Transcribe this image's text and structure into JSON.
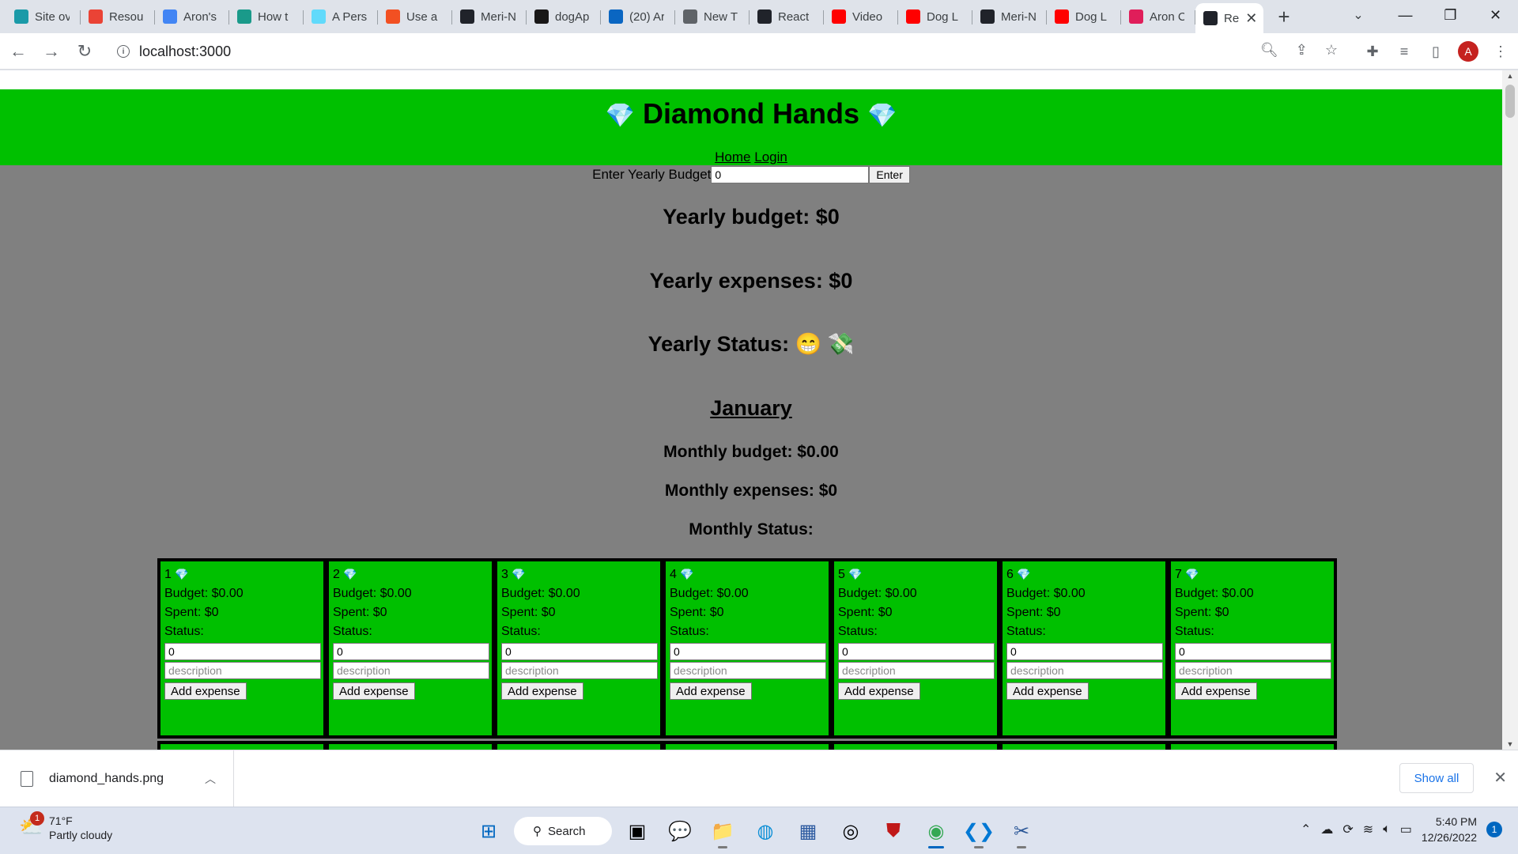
{
  "browser": {
    "tabs": [
      {
        "label": "Site ov",
        "icon": "diamond-icon",
        "color": "#1a9aa8"
      },
      {
        "label": "Resou",
        "icon": "gmail-icon",
        "color": "#ea4335"
      },
      {
        "label": "Aron's",
        "icon": "docs-icon",
        "color": "#4285f4"
      },
      {
        "label": "How t",
        "icon": "link-icon",
        "color": "#1a9a8a"
      },
      {
        "label": "A Pers",
        "icon": "react-icon",
        "color": "#61dafb"
      },
      {
        "label": "Use a",
        "icon": "microsoft-icon",
        "color": "#f25022"
      },
      {
        "label": "Meri-N",
        "icon": "react-icon",
        "color": "#20232a"
      },
      {
        "label": "dogAp",
        "icon": "github-icon",
        "color": "#181717"
      },
      {
        "label": "(20) Ar",
        "icon": "linkedin-icon",
        "color": "#0a66c2"
      },
      {
        "label": "New T",
        "icon": "chrome-icon",
        "color": "#5f6368"
      },
      {
        "label": "React",
        "icon": "react-icon",
        "color": "#20232a"
      },
      {
        "label": "Video",
        "icon": "youtube-icon",
        "color": "#ff0000"
      },
      {
        "label": "Dog L",
        "icon": "youtube-icon",
        "color": "#ff0000"
      },
      {
        "label": "Meri-N",
        "icon": "react-icon",
        "color": "#20232a"
      },
      {
        "label": "Dog L",
        "icon": "youtube-icon",
        "color": "#ff0000"
      },
      {
        "label": "Aron C",
        "icon": "slack-icon",
        "color": "#e01e5a"
      }
    ],
    "active_tab": {
      "label": "Re",
      "icon": "react-icon"
    },
    "url": "localhost:3000",
    "profile_initial": "A"
  },
  "app": {
    "title": "Diamond Hands",
    "gem": "💎",
    "nav": {
      "home": "Home",
      "login": "Login"
    },
    "budget_form": {
      "label": "Enter Yearly Budget",
      "value": "0",
      "button": "Enter"
    },
    "yearly_budget": "Yearly budget: $0",
    "yearly_expenses": "Yearly expenses: $0",
    "yearly_status": "Yearly Status: 😁 💸",
    "month": "January",
    "monthly_budget": "Monthly budget: $0.00",
    "monthly_expenses": "Monthly expenses: $0",
    "monthly_status": "Monthly Status:",
    "days": [
      {
        "num": "1",
        "budget": "Budget: $0.00",
        "spent": "Spent: $0",
        "status": "Status:",
        "amount": "0",
        "desc_placeholder": "description",
        "button": "Add expense"
      },
      {
        "num": "2",
        "budget": "Budget: $0.00",
        "spent": "Spent: $0",
        "status": "Status:",
        "amount": "0",
        "desc_placeholder": "description",
        "button": "Add expense"
      },
      {
        "num": "3",
        "budget": "Budget: $0.00",
        "spent": "Spent: $0",
        "status": "Status:",
        "amount": "0",
        "desc_placeholder": "description",
        "button": "Add expense"
      },
      {
        "num": "4",
        "budget": "Budget: $0.00",
        "spent": "Spent: $0",
        "status": "Status:",
        "amount": "0",
        "desc_placeholder": "description",
        "button": "Add expense"
      },
      {
        "num": "5",
        "budget": "Budget: $0.00",
        "spent": "Spent: $0",
        "status": "Status:",
        "amount": "0",
        "desc_placeholder": "description",
        "button": "Add expense"
      },
      {
        "num": "6",
        "budget": "Budget: $0.00",
        "spent": "Spent: $0",
        "status": "Status:",
        "amount": "0",
        "desc_placeholder": "description",
        "button": "Add expense"
      },
      {
        "num": "7",
        "budget": "Budget: $0.00",
        "spent": "Spent: $0",
        "status": "Status:",
        "amount": "0",
        "desc_placeholder": "description",
        "button": "Add expense"
      }
    ],
    "next_row_count": 7
  },
  "downloads": {
    "file": "diamond_hands.png",
    "show_all": "Show all"
  },
  "taskbar": {
    "weather_temp": "71°F",
    "weather_desc": "Partly cloudy",
    "weather_badge": "1",
    "search_label": "Search",
    "time": "5:40 PM",
    "date": "12/26/2022",
    "notifications": "1"
  }
}
